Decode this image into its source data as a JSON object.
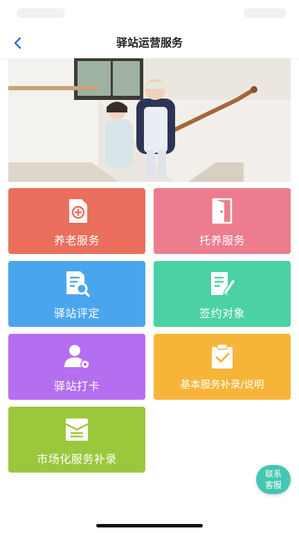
{
  "header": {
    "title": "驿站运营服务",
    "back_icon": "chevron-left-icon"
  },
  "banner": {
    "image": "caregiver-helping-elderly-man-on-stairs"
  },
  "tiles": [
    {
      "label": "养老服务",
      "icon": "add-document-icon",
      "color": "#ea6f5d"
    },
    {
      "label": "托养服务",
      "icon": "door-enter-icon",
      "color": "#ee7c8f"
    },
    {
      "label": "驿站评定",
      "icon": "document-search-icon",
      "color": "#4aa6ec"
    },
    {
      "label": "签约对象",
      "icon": "document-edit-icon",
      "color": "#4cd1a4"
    },
    {
      "label": "驿站打卡",
      "icon": "user-settings-icon",
      "color": "#b46ff0"
    },
    {
      "label": "基本服务补录/说明",
      "icon": "clipboard-check-icon",
      "color": "#f6b539"
    },
    {
      "label": "市场化服务补录",
      "icon": "envelope-card-icon",
      "color": "#9bc73d"
    }
  ],
  "float_button": {
    "line1": "联系",
    "line2": "客服",
    "color": "#44c7b2"
  }
}
